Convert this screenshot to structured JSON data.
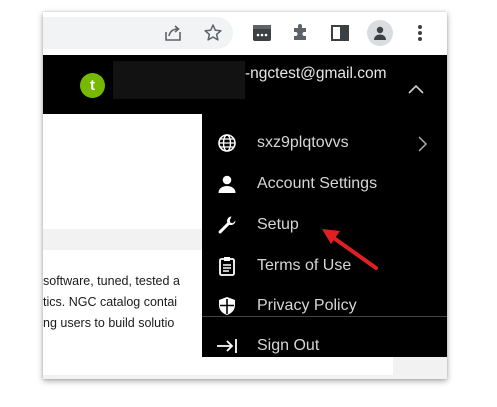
{
  "toolbar": {
    "icons": [
      "share-icon",
      "bookmark-star-icon",
      "extension-nvidia-icon",
      "puzzle-extensions-icon",
      "side-panel-icon",
      "profile-icon",
      "more-vert-icon"
    ]
  },
  "header": {
    "avatar_letter": "t",
    "email_visible": "-ngctest@gmail.com"
  },
  "body_text": {
    "lines": [
      "software, tuned, tested a",
      "tics. NGC catalog contai",
      "ng users to build solutio"
    ]
  },
  "menu": {
    "items": [
      {
        "label": "sxz9plqtovvs",
        "icon": "globe-icon"
      },
      {
        "label": "Account Settings",
        "icon": "person-icon"
      },
      {
        "label": "Setup",
        "icon": "wrench-icon"
      },
      {
        "label": "Terms of Use",
        "icon": "clipboard-icon"
      },
      {
        "label": "Privacy Policy",
        "icon": "shield-icon"
      },
      {
        "label": "Sign Out",
        "icon": "sign-out-icon"
      }
    ]
  },
  "colors": {
    "header_bg": "#000000",
    "menu_bg": "#000000",
    "avatar": "#76b900",
    "annotation_arrow": "#e02020"
  }
}
